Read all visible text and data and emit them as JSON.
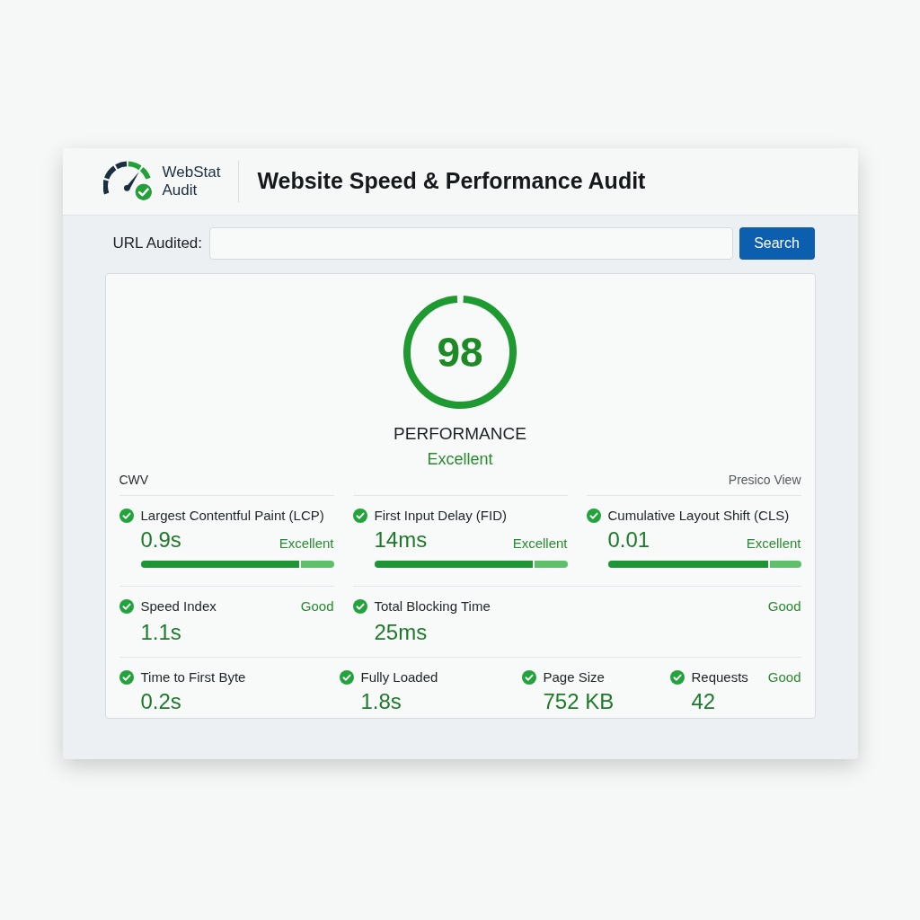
{
  "header": {
    "logo_text": [
      "WebStat",
      "Audit"
    ],
    "title": "Website Speed & Performance Audit"
  },
  "url_bar": {
    "label": "URL Audited:",
    "button": "Search"
  },
  "score": {
    "value": "98",
    "level": 0.98,
    "label": "PERFORMANCE",
    "rating": "Excellent"
  },
  "section": {
    "title": "CWV",
    "view_link": "Presico View"
  },
  "core_metrics": [
    {
      "name": "Largest Contentful Paint (LCP)",
      "value": "0.9s",
      "rating": "Excellent",
      "level": 0.83
    },
    {
      "name": "First Input Delay (FID)",
      "value": "14ms",
      "rating": "Excellent",
      "level": 0.83
    },
    {
      "name": "Cumulative Layout Shift (CLS)",
      "value": "0.01",
      "rating": "Excellent",
      "level": 0.84
    }
  ],
  "secondary_metrics": [
    {
      "kind": "narrow",
      "name": "Speed Index",
      "value": "1.1s",
      "rating": "Good"
    },
    {
      "kind": "wide",
      "name": "Total Blocking Time",
      "value": "25ms",
      "rating": "Good"
    }
  ],
  "other_metrics": {
    "items": [
      {
        "name": "Time to First Byte",
        "value": "0.2s"
      },
      {
        "name": "Fully Loaded",
        "value": "1.8s"
      },
      {
        "name": "Page Size",
        "value": "752 KB"
      },
      {
        "name": "Requests",
        "value": "42"
      }
    ],
    "rating": "Good"
  }
}
